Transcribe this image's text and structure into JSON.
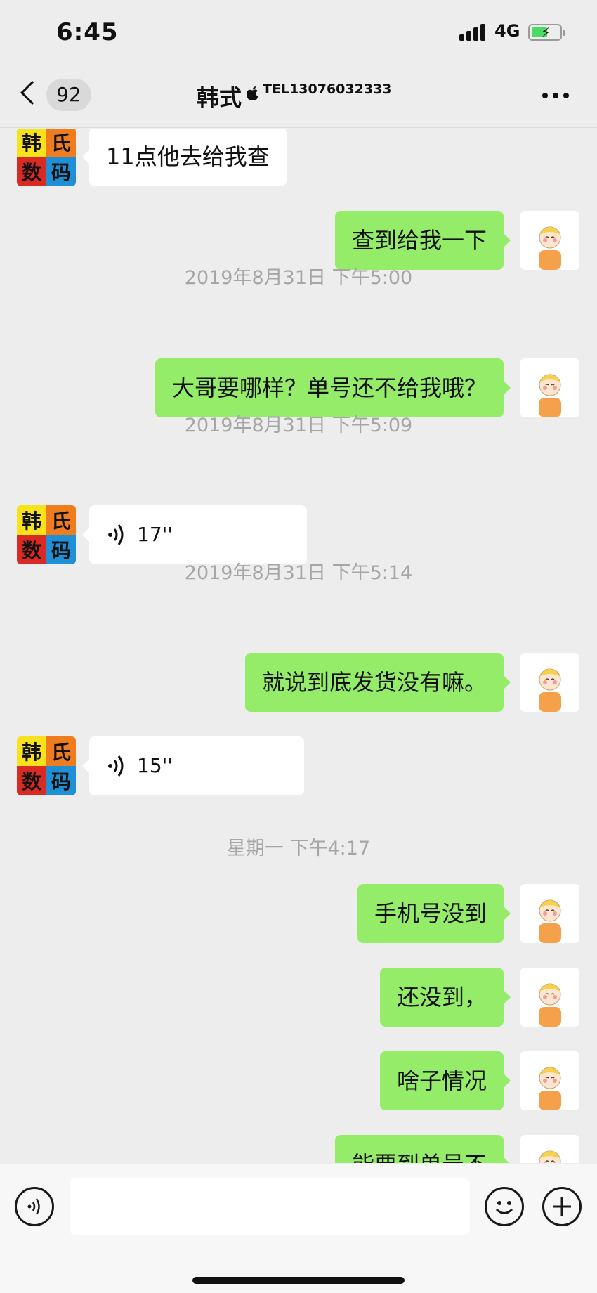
{
  "status_bar": {
    "time": "6:45",
    "network": "4G"
  },
  "nav": {
    "back_count": "92",
    "title": "韩式",
    "subtitle": "TEL13076032333",
    "more_icon": "ellipsis-icon"
  },
  "contact_avatar": {
    "chars": [
      "韩",
      "氏",
      "数",
      "码"
    ],
    "colors": [
      "#f7e21c",
      "#ef7c1e",
      "#d92a23",
      "#1f8fd6"
    ]
  },
  "messages": [
    {
      "side": "left",
      "text": "11点他去给我查"
    },
    {
      "side": "right",
      "text": "查到给我一下"
    },
    {
      "timestamp": "2019年8月31日 下午5:00"
    },
    {
      "side": "right",
      "text": "大哥要哪样？单号还不给我哦？"
    },
    {
      "timestamp": "2019年8月31日 下午5:09"
    },
    {
      "side": "left",
      "voice": "17''"
    },
    {
      "timestamp": "2019年8月31日 下午5:14"
    },
    {
      "side": "right",
      "text": "就说到底发货没有嘛。"
    },
    {
      "side": "left",
      "voice": "15''"
    },
    {
      "timestamp": "星期一 下午4:17"
    },
    {
      "side": "right",
      "text": "手机号没到"
    },
    {
      "side": "right",
      "text": "还没到，"
    },
    {
      "side": "right",
      "text": "啥子情况"
    },
    {
      "side": "right",
      "text": "能要到单号不"
    }
  ],
  "input_bar": {
    "voice_icon": "voice-mode-icon",
    "emoji_icon": "emoji-icon",
    "plus_icon": "plus-icon"
  }
}
